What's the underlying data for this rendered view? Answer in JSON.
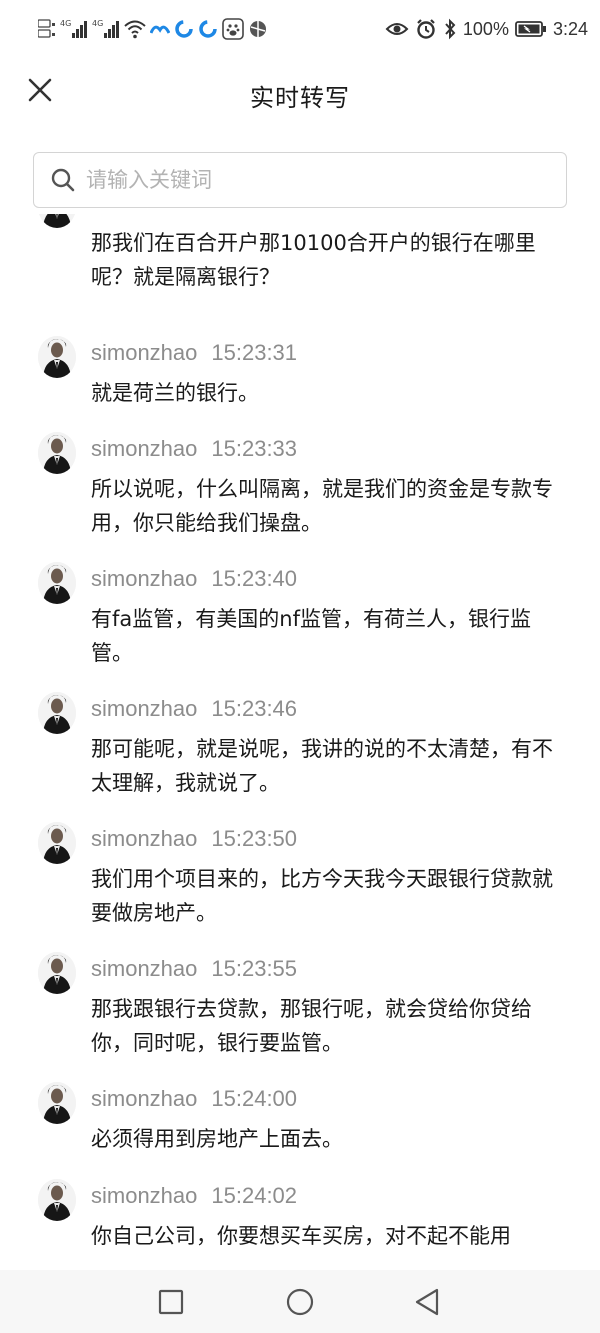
{
  "status_bar": {
    "battery_percent": "100%",
    "time": "3:24",
    "left_icons": [
      "hd-sim1-icon",
      "signal-4g-icon",
      "signal-4g-icon",
      "wifi-icon",
      "app-notification-icon",
      "app-notification-icon",
      "app-notification-icon",
      "baidu-icon",
      "app-icon"
    ],
    "right_icons": [
      "eye-icon",
      "alarm-icon",
      "bluetooth-icon",
      "battery-icon"
    ]
  },
  "header": {
    "title": "实时转写",
    "close_icon": "close-icon"
  },
  "search": {
    "placeholder": "请输入关键词",
    "icon": "search-icon"
  },
  "transcript": [
    {
      "speaker": "",
      "time": "",
      "text": "那我们在百合开户那10100合开户的银行在哪里呢？就是隔离银行？"
    },
    {
      "speaker": "simonzhao",
      "time": "15:23:31",
      "text": "就是荷兰的银行。"
    },
    {
      "speaker": "simonzhao",
      "time": "15:23:33",
      "text": "所以说呢，什么叫隔离，就是我们的资金是专款专用，你只能给我们操盘。"
    },
    {
      "speaker": "simonzhao",
      "time": "15:23:40",
      "text": "有fa监管，有美国的nf监管，有荷兰人，银行监管。"
    },
    {
      "speaker": "simonzhao",
      "time": "15:23:46",
      "text": "那可能呢，就是说呢，我讲的说的不太清楚，有不太理解，我就说了。"
    },
    {
      "speaker": "simonzhao",
      "time": "15:23:50",
      "text": "我们用个项目来的，比方今天我今天跟银行贷款就要做房地产。"
    },
    {
      "speaker": "simonzhao",
      "time": "15:23:55",
      "text": "那我跟银行去贷款，那银行呢，就会贷给你贷给你，同时呢，银行要监管。"
    },
    {
      "speaker": "simonzhao",
      "time": "15:24:00",
      "text": "必须得用到房地产上面去。"
    },
    {
      "speaker": "simonzhao",
      "time": "15:24:02",
      "text": "你自己公司，你要想买车买房，对不起不能用"
    }
  ],
  "nav_bar": {
    "buttons": [
      "recent-apps-icon",
      "home-icon",
      "back-icon"
    ]
  },
  "colors": {
    "text_primary": "#1a1a1a",
    "text_secondary": "#8c8c8c",
    "placeholder": "#b3b3b3",
    "border": "#d4d4d4",
    "nav_bg": "#f7f7f7"
  }
}
